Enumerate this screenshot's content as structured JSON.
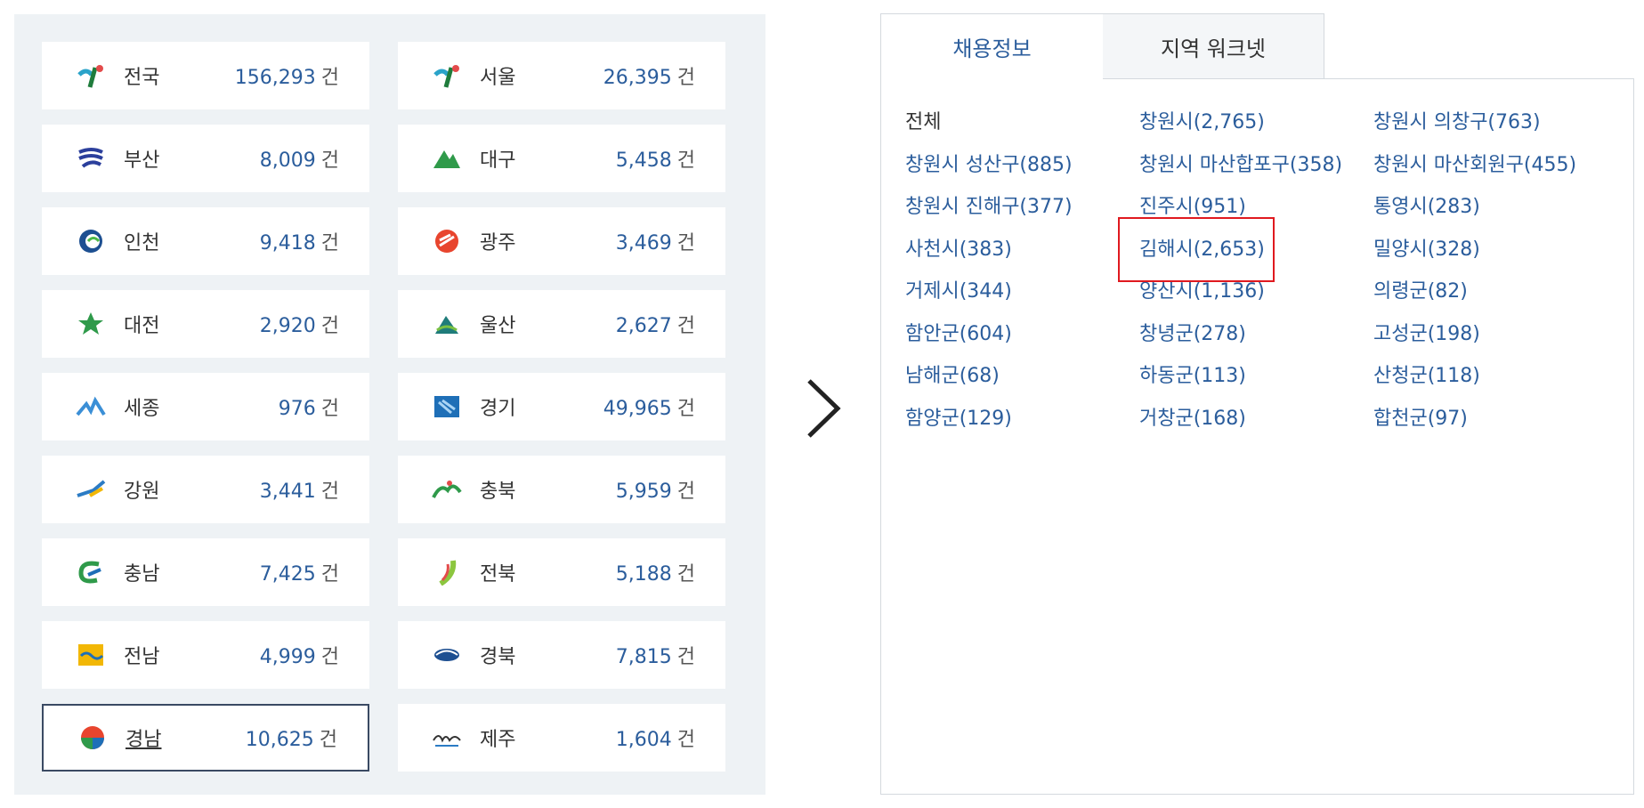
{
  "regions_left": [
    {
      "name": "전국",
      "count": "156,293",
      "unit": "건",
      "logo": "national-icon"
    },
    {
      "name": "서울",
      "count": "26,395",
      "unit": "건",
      "logo": "seoul-icon"
    },
    {
      "name": "부산",
      "count": "8,009",
      "unit": "건",
      "logo": "busan-icon"
    },
    {
      "name": "대구",
      "count": "5,458",
      "unit": "건",
      "logo": "daegu-icon"
    },
    {
      "name": "인천",
      "count": "9,418",
      "unit": "건",
      "logo": "incheon-icon"
    },
    {
      "name": "광주",
      "count": "3,469",
      "unit": "건",
      "logo": "gwangju-icon"
    },
    {
      "name": "대전",
      "count": "2,920",
      "unit": "건",
      "logo": "daejeon-icon"
    },
    {
      "name": "울산",
      "count": "2,627",
      "unit": "건",
      "logo": "ulsan-icon"
    },
    {
      "name": "세종",
      "count": "976",
      "unit": "건",
      "logo": "sejong-icon"
    },
    {
      "name": "경기",
      "count": "49,965",
      "unit": "건",
      "logo": "gyeonggi-icon"
    },
    {
      "name": "강원",
      "count": "3,441",
      "unit": "건",
      "logo": "gangwon-icon"
    },
    {
      "name": "충북",
      "count": "5,959",
      "unit": "건",
      "logo": "chungbuk-icon"
    },
    {
      "name": "충남",
      "count": "7,425",
      "unit": "건",
      "logo": "chungnam-icon"
    },
    {
      "name": "전북",
      "count": "5,188",
      "unit": "건",
      "logo": "jeonbuk-icon"
    },
    {
      "name": "전남",
      "count": "4,999",
      "unit": "건",
      "logo": "jeonnam-icon"
    },
    {
      "name": "경북",
      "count": "7,815",
      "unit": "건",
      "logo": "gyeongbuk-icon"
    },
    {
      "name": "경남",
      "count": "10,625",
      "unit": "건",
      "logo": "gyeongnam-icon",
      "selected": true
    },
    {
      "name": "제주",
      "count": "1,604",
      "unit": "건",
      "logo": "jeju-icon"
    }
  ],
  "tabs": [
    {
      "label": "채용정보",
      "active": true
    },
    {
      "label": "지역 워크넷",
      "active": false
    }
  ],
  "sub_regions": [
    "전체",
    "창원시(2,765)",
    "창원시 의창구(763)",
    "창원시 성산구(885)",
    "창원시 마산합포구(358)",
    "창원시 마산회원구(455)",
    "창원시 진해구(377)",
    "진주시(951)",
    "통영시(283)",
    "사천시(383)",
    "김해시(2,653)",
    "밀양시(328)",
    "거제시(344)",
    "양산시(1,136)",
    "의령군(82)",
    "함안군(604)",
    "창녕군(278)",
    "고성군(198)",
    "남해군(68)",
    "하동군(113)",
    "산청군(118)",
    "함양군(129)",
    "거창군(168)",
    "합천군(97)"
  ],
  "colors": {
    "accent": "#2b5d9c",
    "highlight": "#e0191f",
    "panel_bg": "#eef2f5"
  }
}
